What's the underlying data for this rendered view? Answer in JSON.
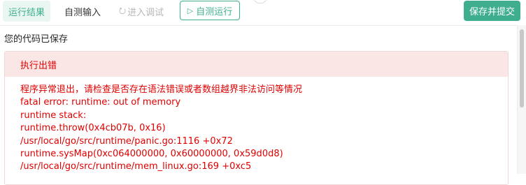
{
  "toolbar": {
    "tab_run_result": "运行结果",
    "tab_custom_input": "自测输入",
    "tab_debug": "进入调试",
    "debug_icon": "lock-icon",
    "selftest_label": "自测运行",
    "selftest_icon": "play-icon",
    "submit_label": "保存并提交"
  },
  "status": {
    "saved": "您的代码已保存"
  },
  "error": {
    "title": "执行出错",
    "lines": [
      "程序异常退出，请检查是否存在语法错误或者数组越界非法访问等情况",
      "fatal error: runtime: out of memory",
      "runtime stack:",
      "runtime.throw(0x4cb07b, 0x16)",
      "/usr/local/go/src/runtime/panic.go:1116 +0x72",
      "runtime.sysMap(0xc064000000, 0x60000000, 0x59d0d8)",
      "/usr/local/go/src/runtime/mem_linux.go:169 +0xc5"
    ]
  },
  "colors": {
    "accent": "#3fae8f",
    "error_text": "#e00000",
    "error_header_bg": "#fbe6e6"
  }
}
